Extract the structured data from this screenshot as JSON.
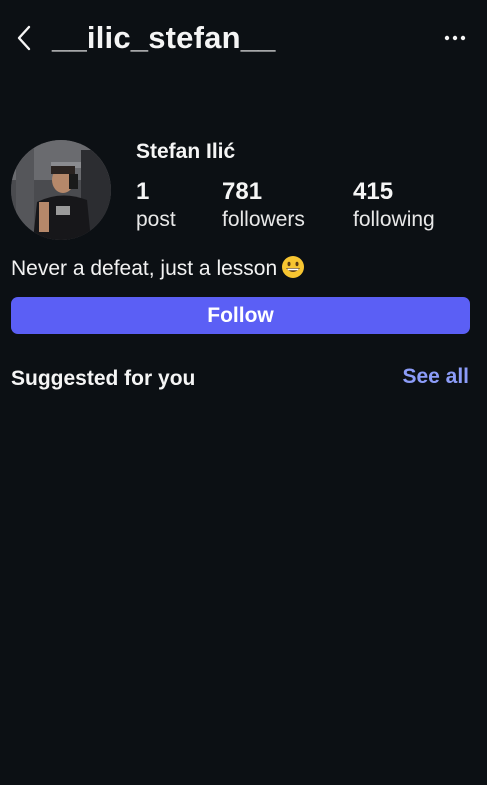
{
  "header": {
    "back_icon": "chevron-left-icon",
    "username": "__ilic_stefan__",
    "more_icon": "more-horizontal-icon"
  },
  "profile": {
    "display_name": "Stefan Ilić",
    "stats": {
      "posts": {
        "count": "1",
        "label": "post"
      },
      "followers": {
        "count": "781",
        "label": "followers"
      },
      "following": {
        "count": "415",
        "label": "following"
      }
    },
    "bio": "Never a defeat, just a lesson",
    "bio_emoji": "grinning-face-emoji",
    "follow_label": "Follow"
  },
  "suggestions": {
    "title": "Suggested for you",
    "see_all_label": "See all"
  },
  "colors": {
    "background": "#0c1014",
    "follow_button": "#5b5ff5",
    "link": "#8c9cf8"
  }
}
